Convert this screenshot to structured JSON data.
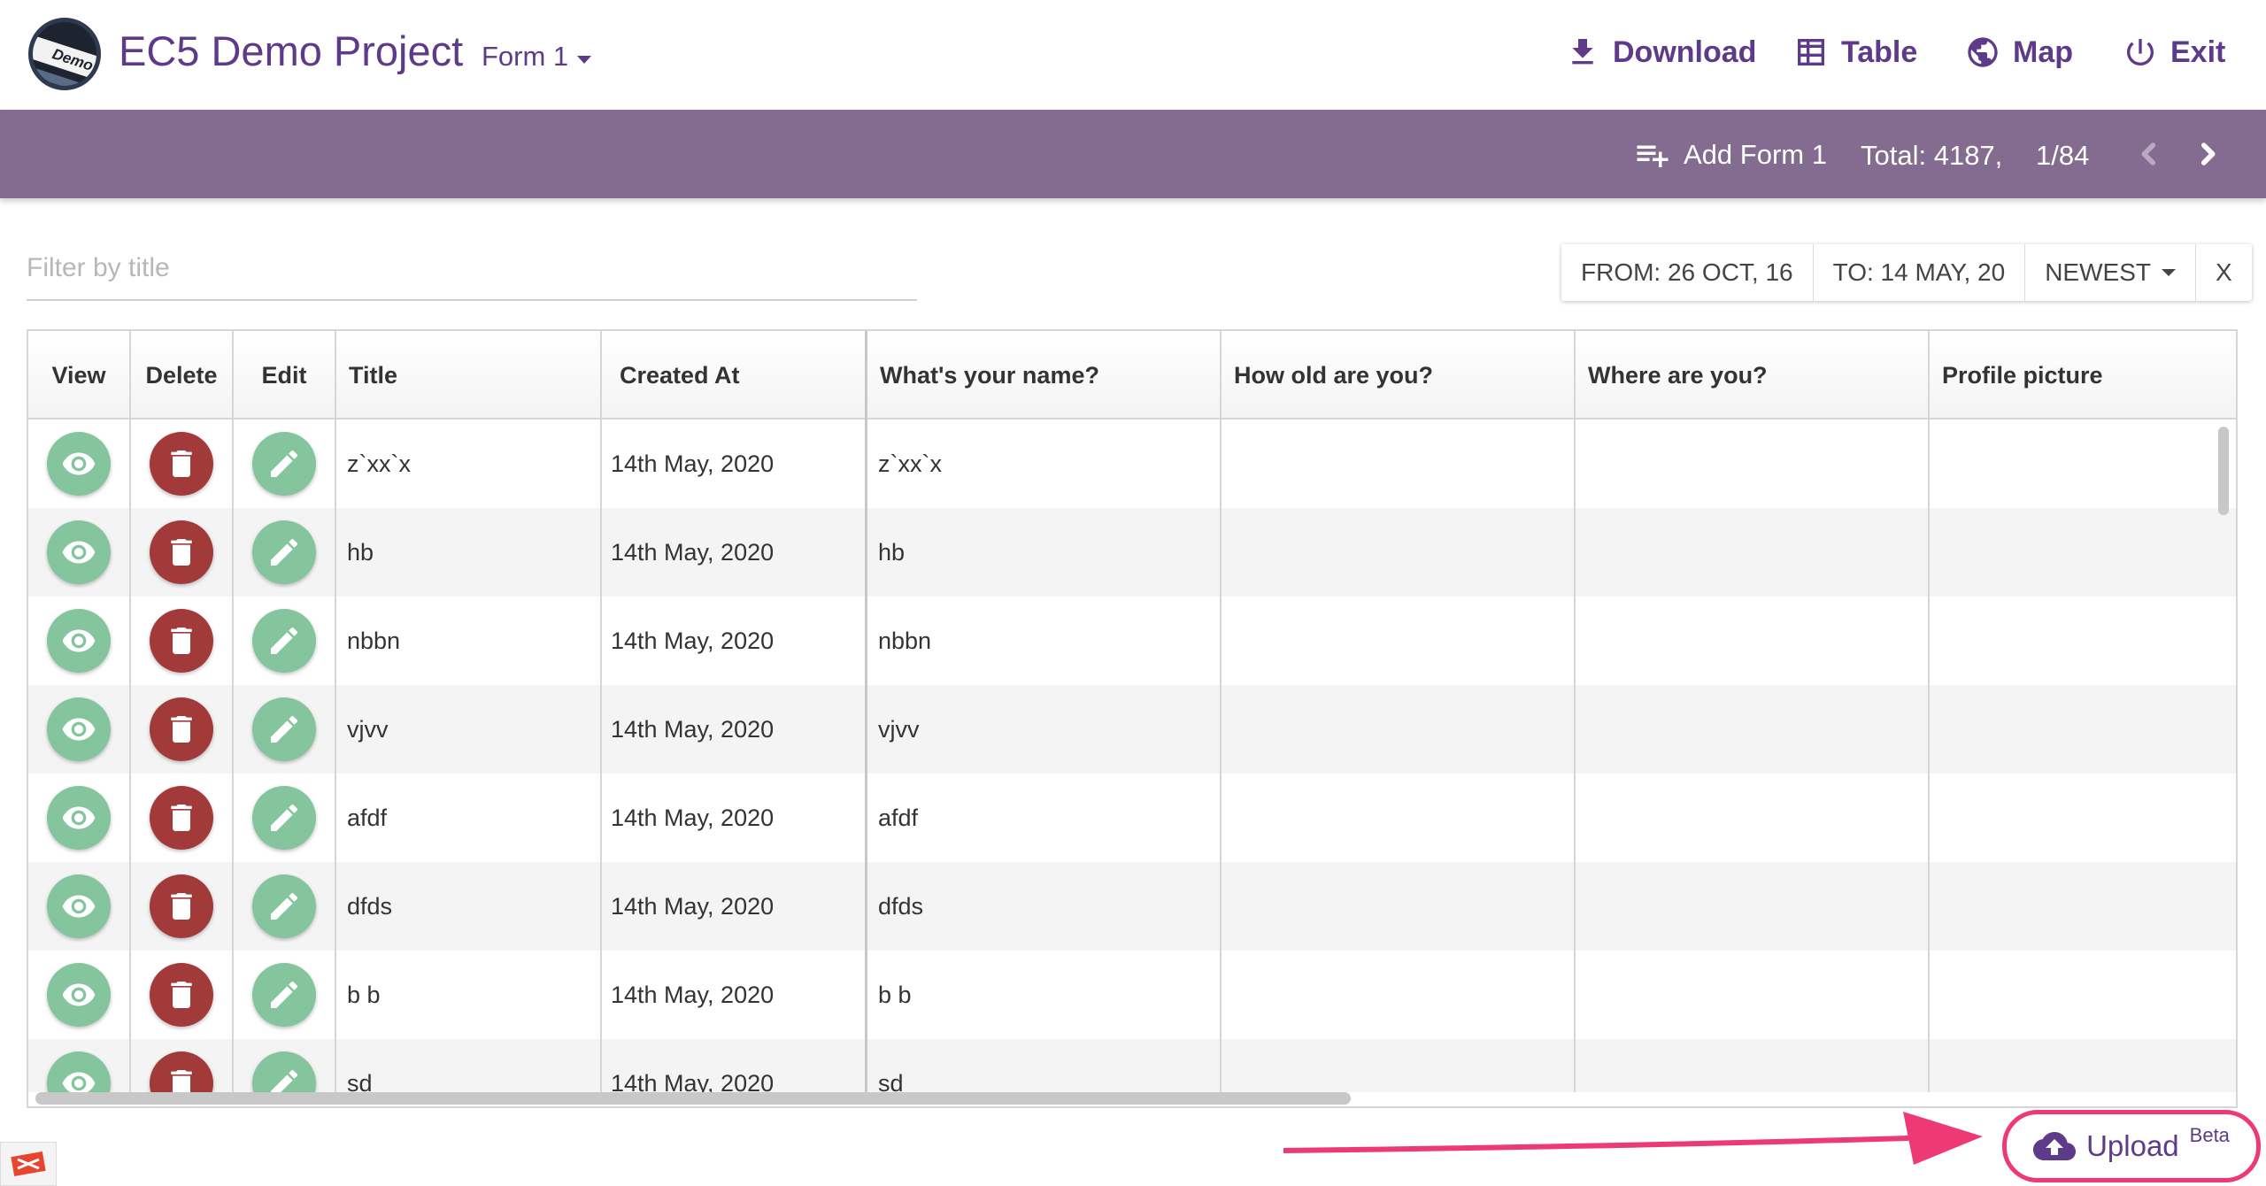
{
  "header": {
    "logo_text": "Demo",
    "project_title": "EC5 Demo Project",
    "form_selector": "Form 1",
    "nav": {
      "download": "Download",
      "table": "Table",
      "map": "Map",
      "exit": "Exit"
    }
  },
  "toolbar": {
    "add_label": "Add Form 1",
    "total": "Total: 4187,",
    "page": "1/84"
  },
  "filter": {
    "placeholder": "Filter by title"
  },
  "date_filter": {
    "from": "FROM: 26 OCT, 16",
    "to": "TO: 14 MAY, 20",
    "sort": "NEWEST",
    "clear": "X"
  },
  "table": {
    "columns": [
      "View",
      "Delete",
      "Edit",
      "Title",
      "Created At",
      "What's your name?",
      "How old are you?",
      "Where are you?",
      "Profile picture"
    ],
    "rows": [
      {
        "title": "z`xx`x",
        "created": "14th May, 2020",
        "name": "z`xx`x",
        "age": "",
        "where": "",
        "picture": ""
      },
      {
        "title": "hb",
        "created": "14th May, 2020",
        "name": "hb",
        "age": "",
        "where": "",
        "picture": ""
      },
      {
        "title": "nbbn",
        "created": "14th May, 2020",
        "name": "nbbn",
        "age": "",
        "where": "",
        "picture": ""
      },
      {
        "title": "vjvv",
        "created": "14th May, 2020",
        "name": "vjvv",
        "age": "",
        "where": "",
        "picture": ""
      },
      {
        "title": "afdf",
        "created": "14th May, 2020",
        "name": "afdf",
        "age": "",
        "where": "",
        "picture": ""
      },
      {
        "title": "dfds",
        "created": "14th May, 2020",
        "name": "dfds",
        "age": "",
        "where": "",
        "picture": ""
      },
      {
        "title": "b b",
        "created": "14th May, 2020",
        "name": "b b",
        "age": "",
        "where": "",
        "picture": ""
      },
      {
        "title": "sd",
        "created": "14th May, 2020",
        "name": "sd",
        "age": "",
        "where": "",
        "picture": ""
      }
    ]
  },
  "upload": {
    "label": "Upload",
    "badge": "Beta"
  },
  "colors": {
    "brand_purple": "#5e3a8a",
    "toolbar_bg": "#836c8f",
    "view_green": "#85c59e",
    "delete_red": "#a33a3a",
    "annotation_pink": "#ee3a74"
  }
}
